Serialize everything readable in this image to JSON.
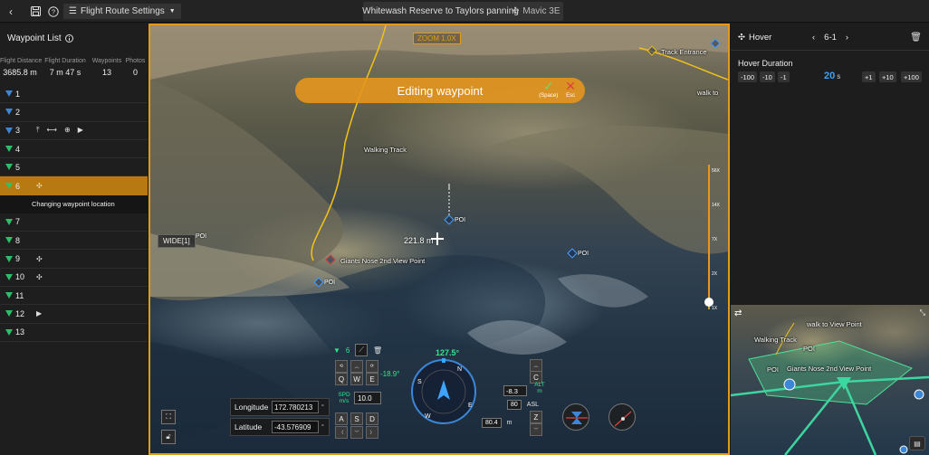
{
  "topbar": {
    "route_settings_label": "Flight Route Settings",
    "route_title": "Whitewash Reserve to Taylors panning",
    "drone_name": "Mavic 3E"
  },
  "left_panel": {
    "title": "Waypoint List",
    "stats": [
      {
        "label": "Flight Distance",
        "value": "3685.8 m"
      },
      {
        "label": "Flight Duration",
        "value": "7 m 47 s"
      },
      {
        "label": "Waypoints",
        "value": "13"
      },
      {
        "label": "Photos",
        "value": "0"
      }
    ],
    "waypoints": [
      {
        "num": "1",
        "color": "blue",
        "icons": []
      },
      {
        "num": "2",
        "color": "blue",
        "icons": []
      },
      {
        "num": "3",
        "color": "blue",
        "icons": [
          "gimbal-icon",
          "pan-icon",
          "zoom-icon",
          "record-icon"
        ]
      },
      {
        "num": "4",
        "color": "green",
        "icons": []
      },
      {
        "num": "5",
        "color": "green",
        "icons": []
      },
      {
        "num": "6",
        "color": "green",
        "icons": [
          "hover-icon"
        ],
        "active": true
      },
      {
        "num": "7",
        "color": "green",
        "icons": []
      },
      {
        "num": "8",
        "color": "green",
        "icons": []
      },
      {
        "num": "9",
        "color": "green",
        "icons": [
          "hover-icon"
        ]
      },
      {
        "num": "10",
        "color": "green",
        "icons": [
          "hover-icon"
        ]
      },
      {
        "num": "11",
        "color": "green",
        "icons": []
      },
      {
        "num": "12",
        "color": "green",
        "icons": [
          "record-icon"
        ]
      },
      {
        "num": "13",
        "color": "green",
        "icons": []
      }
    ],
    "active_note": "Changing waypoint location"
  },
  "main_view": {
    "zoom_badge": "ZOOM 1.0X",
    "edit_banner": "Editing waypoint",
    "confirm_label": "(Space)",
    "cancel_label": "Esc",
    "wide_badge": "WIDE[1]",
    "distance_label": "221.8 m",
    "map_labels": {
      "walking_track": "Walking Track",
      "view_point": "Giants Nose 2nd View Point",
      "track_entrance": "Track Entrance",
      "walk_to": "walk to"
    },
    "poi_label": "POI",
    "zoom_ticks": [
      "56X",
      "14X",
      "7X",
      "2X",
      "1X"
    ],
    "hud": {
      "waypoint_index": "6",
      "heading": "127.5°",
      "pitch": "-18.9°",
      "spd_label": "SPD m/s",
      "spd_value": "10.0",
      "longitude_label": "Longitude",
      "longitude_value": "172.780213",
      "latitude_label": "Latitude",
      "latitude_value": "-43.576909",
      "deg_unit": "°",
      "alt_value": "-8.3",
      "alt_label": "ALT m",
      "asl_value": "80",
      "asl_label": "ASL",
      "ground_value": "80.4",
      "ground_unit": "m",
      "keys_top": [
        "Q",
        "W",
        "E"
      ],
      "keys_bottom": [
        "A",
        "S",
        "D"
      ],
      "key_c": "C",
      "key_z": "Z",
      "compass_letters": [
        "N",
        "E",
        "S",
        "W"
      ]
    }
  },
  "right_panel": {
    "title": "Hover",
    "waypoint_nav": "6-1",
    "duration_label": "Hover Duration",
    "buttons_minus": [
      "-100",
      "-10",
      "-1"
    ],
    "buttons_plus": [
      "+1",
      "+10",
      "+100"
    ],
    "duration_value": "20",
    "duration_unit": "s"
  },
  "minimap": {
    "labels": {
      "walk_to": "walk to View Point",
      "walking_track": "Walking Track",
      "view_point": "Giants Nose 2nd View Point",
      "poi": "POI"
    }
  },
  "colors": {
    "accent": "#e39a1b",
    "active_row": "#b77a12",
    "waypoint_blue": "#3b86d6",
    "waypoint_green": "#2bbf6a",
    "value_blue": "#3ea2ff"
  }
}
